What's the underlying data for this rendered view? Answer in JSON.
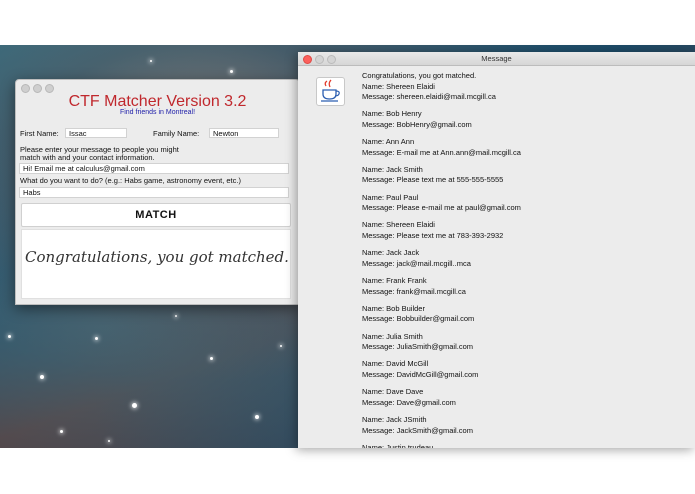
{
  "matcher": {
    "title": "CTF Matcher Version 3.2",
    "subtitle": "Find friends in Montreal!",
    "first_name_label": "First Name:",
    "first_name_value": "Issac",
    "family_name_label": "Family Name:",
    "family_name_value": "Newton",
    "message_prompt_line1": "Please enter your message to people you might",
    "message_prompt_line2": "match with and your contact information.",
    "message_value": "Hi! Email me at calculus@gmail.com",
    "activity_prompt": "What do you want to do? (e.g.: Habs game, astronomy event, etc.)",
    "activity_value": "Habs",
    "match_button": "MATCH",
    "result_text": "Congratulations, you got matched."
  },
  "message_window": {
    "title": "Message",
    "header": "Congratulations, you got matched.",
    "entries": [
      {
        "name": "Name: Shereen Elaidi",
        "message": "Message: shereen.elaidi@mail.mcgill.ca"
      },
      {
        "name": "Name: Bob Henry",
        "message": "Message: BobHenry@gmail.com"
      },
      {
        "name": "Name: Ann Ann",
        "message": "Message: E-mail me at Ann.ann@mail.mcgill.ca"
      },
      {
        "name": "Name: Jack Smith",
        "message": "Message: Please text me at 555-555-5555"
      },
      {
        "name": "Name: Paul Paul",
        "message": "Message: Please e-mail me at paul@gmail.com"
      },
      {
        "name": "Name: Shereen Elaidi",
        "message": "Message: Please text me at 783-393-2932"
      },
      {
        "name": "Name: Jack Jack",
        "message": "Message: jack@mail.mcgill..mca"
      },
      {
        "name": "Name: Frank Frank",
        "message": "Message: frank@mail.mcgill.ca"
      },
      {
        "name": "Name: Bob Builder",
        "message": "Message: Bobbuilder@gmail.com"
      },
      {
        "name": "Name: Julia Smith",
        "message": "Message: JuliaSmith@gmail.com"
      },
      {
        "name": "Name: David McGill",
        "message": "Message: DavidMcGill@gmail.com"
      },
      {
        "name": "Name: Dave Dave",
        "message": "Message: Dave@gmail.com"
      },
      {
        "name": "Name: Jack JSmith",
        "message": "Message: JackSmith@gmail.com"
      },
      {
        "name": "Name: Justin trudeau",
        "message": ""
      }
    ]
  },
  "icons": {
    "java": "java-coffee-cup-icon",
    "traffic_lights": [
      "close-icon",
      "minimize-icon",
      "zoom-icon"
    ]
  },
  "colors": {
    "title_red": "#c0282d",
    "subtitle_blue": "#2222aa",
    "close_red": "#fc605c",
    "window_gray": "#ececec"
  }
}
